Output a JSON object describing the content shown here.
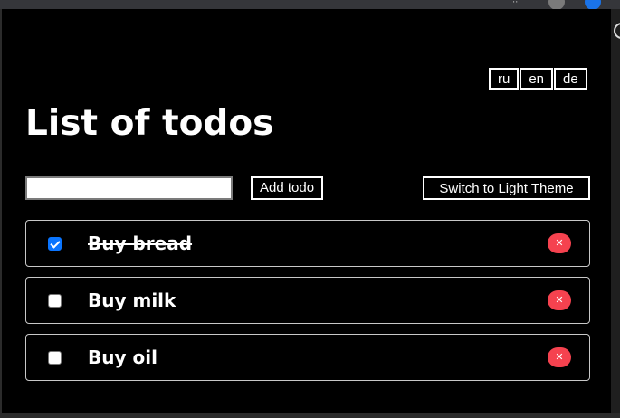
{
  "languages": [
    "ru",
    "en",
    "de"
  ],
  "title": "List of todos",
  "input": {
    "value": "",
    "placeholder": ""
  },
  "add_label": "Add todo",
  "theme_toggle_label": "Switch to Light Theme",
  "todos": [
    {
      "text": "Buy bread",
      "done": true
    },
    {
      "text": "Buy milk",
      "done": false
    },
    {
      "text": "Buy oil",
      "done": false
    }
  ],
  "icons": {
    "delete": "close-icon"
  },
  "colors": {
    "background": "#000000",
    "text": "#ffffff",
    "delete": "#f5424f",
    "checkbox_checked": "#0a75ff"
  }
}
